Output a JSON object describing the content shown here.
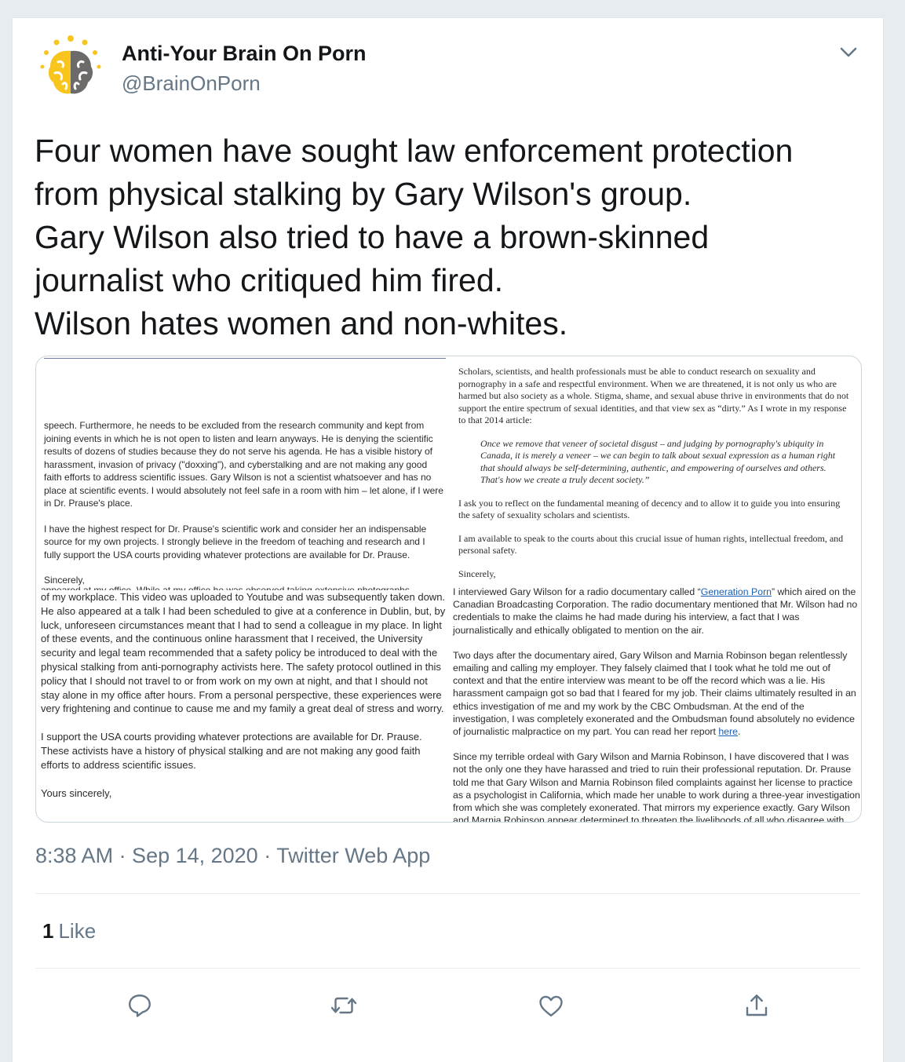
{
  "tweet": {
    "author_name": "Anti-Your Brain On Porn",
    "author_handle": "@BrainOnPorn",
    "text_lines": [
      "Four women have sought law enforcement protection",
      "from physical stalking by Gary Wilson's group.",
      "Gary Wilson also tried to have a brown-skinned",
      "journalist who critiqued him fired.",
      "Wilson hates women and non-whites."
    ],
    "timestamp": "8:38 AM · Sep 14, 2020 · Twitter Web App",
    "likes_count": "1",
    "likes_label": "Like"
  },
  "letters": {
    "q1": {
      "p1": "speech. Furthermore, he needs to be excluded from the research community and kept from joining events in which he is not open to listen and learn anyways. He is denying the scientific results of dozens of studies because they do not serve his agenda. He has a visible history of harassment, invasion of privacy (\"doxxing\"), and cyberstalking and are not making any good faith efforts to address scientific issues. Gary Wilson is not a scientist whatsoever and has no place at scientific events. I would absolutely not feel safe in a room with him – let alone, if I were in Dr. Prause's place.",
      "p2": "I have the highest respect for Dr. Prause's scientific work and consider her an indispensable source for my own projects. I strongly believe in the freedom of teaching and research and I fully support the USA courts providing whatever protections are available for Dr. Prause.",
      "p3": "Sincerely,"
    },
    "q2": {
      "p1": "Scholars, scientists, and health professionals must be able to conduct research on sexuality and pornography in a safe and respectful environment. When we are threatened, it is not only us who are harmed but also society as a whole. Stigma, shame, and sexual abuse thrive in environments that do not support the entire spectrum of sexual identities, and that view sex as “dirty.” As I wrote in my response to that 2014 article:",
      "quote": "Once we remove that veneer of societal disgust – and judging by pornography's ubiquity in Canada, it is merely a veneer – we can begin to talk about sexual expression as a human right that should always be self-determining, authentic, and empowering of ourselves and others. That's how we create a truly decent society.”",
      "p2": "I ask you to reflect on the fundamental meaning of decency and to allow it to guide you into ensuring the safety of sexuality scholars and scientists.",
      "p3": "I am available to speak to the courts about this crucial issue of human rights, intellectual freedom, and personal safety.",
      "p4": "Sincerely,"
    },
    "q3": {
      "cut": "appeared at my office. While at my office he was observed taking extensive photographs",
      "p1": "of my workplace. This video was uploaded to Youtube and was subsequently taken down. He also appeared at a talk I had been scheduled to give at a conference in Dublin, but, by luck, unforeseen circumstances meant that I had to send a colleague in my place. In light of these events, and the continuous online harassment that I received, the University security and legal team recommended that a safety policy be introduced to deal with the physical stalking from anti-pornography activists here. The safety protocol outlined in this policy that I should not travel to or from work on my own at night, and that I should not stay alone in my office after hours. From a personal perspective, these experiences were very frightening and continue to cause me and my family a great deal of stress and worry.",
      "p2": "I support the USA courts providing whatever protections are available for Dr. Prause. These activists have a history of physical stalking and are not making any good faith efforts to address scientific issues.",
      "p3": "Yours sincerely,"
    },
    "q4": {
      "p1_a": "I interviewed Gary Wilson for a radio documentary called “",
      "p1_link": "Generation Porn",
      "p1_b": "” which aired on the Canadian Broadcasting Corporation. The radio documentary mentioned that Mr. Wilson had no credentials to make the claims he had made during his interview, a fact that I was journalistically and ethically obligated to mention on the air.",
      "p2_a": "Two days after the documentary aired, Gary Wilson and Marnia Robinson began relentlessly emailing and calling my employer. They falsely claimed that I took what he told me out of context and that the entire interview was meant to be off the record which was a lie. His harassment campaign got so bad that I feared for my job. Their claims ultimately resulted in an ethics investigation of me and my work by the CBC Ombudsman. At the end of the investigation, I was completely exonerated and the Ombudsman found absolutely no evidence of journalistic malpractice on my part. You can read her report ",
      "p2_link": "here",
      "p2_b": ".",
      "p3": "Since my terrible ordeal with Gary Wilson and Marnia Robinson, I have discovered that I was not the only one they have harassed and tried to ruin their professional reputation. Dr. Prause told me that Gary Wilson and Marnia Robinson filed complaints against her license to practice as a psychologist in California, which made her unable to work during a three-year investigation from which she was completely exonerated. That mirrors my experience exactly. Gary Wilson and Marnia Robinson appear determined to threaten the livelihoods of all who disagree with"
    }
  },
  "icons": {
    "avatar": "brain-avatar-icon",
    "caret": "chevron-down-icon",
    "reply": "reply-icon",
    "retweet": "retweet-icon",
    "like": "heart-icon",
    "share": "share-icon"
  },
  "colors": {
    "secondary_text": "#657786",
    "icon": "#657786",
    "link": "#1a5fb4",
    "avatar_yellow": "#f7c51e",
    "avatar_gray": "#6d6a6a"
  }
}
